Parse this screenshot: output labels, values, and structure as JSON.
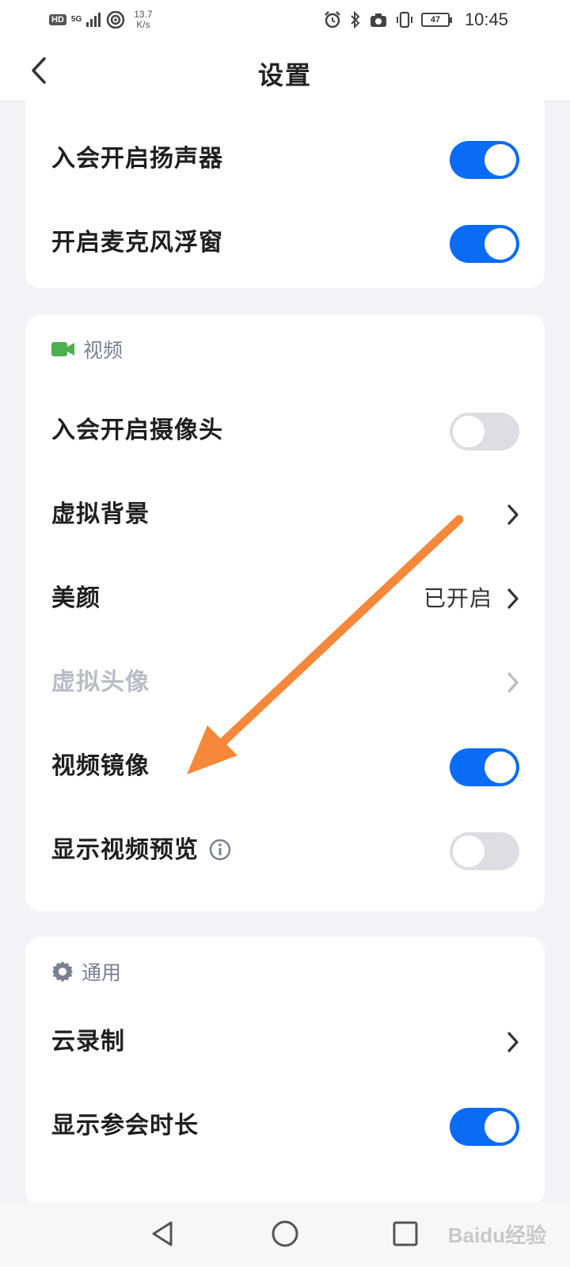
{
  "status_bar": {
    "hd": "HD",
    "network": "5G",
    "speed_value": "13.7",
    "speed_unit": "K/s",
    "battery": "47",
    "time": "10:45"
  },
  "header": {
    "title": "设置"
  },
  "audio_section": {
    "items": [
      {
        "label": "入会开启扬声器",
        "toggle": true
      },
      {
        "label": "开启麦克风浮窗",
        "toggle": true
      }
    ]
  },
  "video_section": {
    "title": "视频",
    "icon": "video-camera-icon",
    "icon_color": "#4caf50",
    "items": [
      {
        "label": "入会开启摄像头",
        "toggle": false
      },
      {
        "label": "虚拟背景",
        "type": "link"
      },
      {
        "label": "美颜",
        "type": "link",
        "value": "已开启"
      },
      {
        "label": "虚拟头像",
        "type": "link",
        "disabled": true
      },
      {
        "label": "视频镜像",
        "toggle": true
      },
      {
        "label": "显示视频预览",
        "toggle": false,
        "info_icon": "info-icon"
      }
    ]
  },
  "general_section": {
    "title": "通用",
    "icon": "gear-icon",
    "items": [
      {
        "label": "云录制",
        "type": "link"
      },
      {
        "label": "显示参会时长",
        "toggle": true
      }
    ]
  },
  "colors": {
    "accent": "#0a6cf5",
    "toggle_off": "#dcdee3",
    "annotation_arrow": "#f5883a"
  },
  "watermark": "Baidu经验"
}
